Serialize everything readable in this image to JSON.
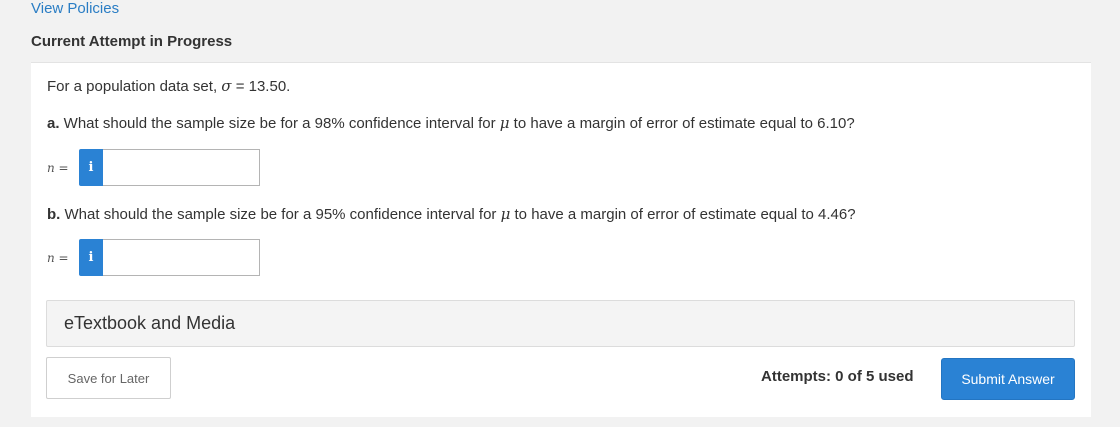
{
  "header": {
    "view_policies": "View Policies",
    "attempt_status": "Current Attempt in Progress"
  },
  "problem": {
    "statement_prefix": "For a population data set, ",
    "sigma_symbol": "σ",
    "statement_suffix": " = 13.50.",
    "mu_symbol": "μ",
    "part_a": {
      "letter": "a.",
      "text_before_mu": " What should the sample size be for a 98% confidence interval for ",
      "text_after_mu": " to have a margin of error of estimate equal to 6.10?",
      "answer_label": "n =",
      "answer_value": ""
    },
    "part_b": {
      "letter": "b.",
      "text_before_mu": " What should the sample size be for a 95% confidence interval for ",
      "text_after_mu": " to have a margin of error of estimate equal to 4.46?",
      "answer_label": "n =",
      "answer_value": ""
    }
  },
  "info_button": {
    "glyph": "i",
    "icon": "info-icon"
  },
  "media": {
    "label": "eTextbook and Media"
  },
  "footer": {
    "save_label": "Save for Later",
    "attempts_text": "Attempts: 0 of 5 used",
    "submit_label": "Submit Answer"
  },
  "colors": {
    "accent": "#2a82d4",
    "link": "#2a7dc4",
    "background": "#f2f2f2"
  }
}
